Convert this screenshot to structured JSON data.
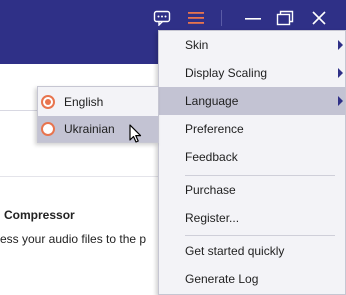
{
  "titlebar": {
    "icons": [
      "chat-icon",
      "menu-icon",
      "minimize-icon",
      "restore-icon",
      "close-icon"
    ],
    "menu_icon_color": "#e8744e"
  },
  "background": {
    "app_name": "Compressor",
    "description": "ess your audio files to the p"
  },
  "menu": {
    "items": [
      {
        "label": "Skin",
        "has_submenu": true
      },
      {
        "label": "Display Scaling",
        "has_submenu": true
      },
      {
        "label": "Language",
        "has_submenu": true,
        "active": true
      },
      {
        "label": "Preference"
      },
      {
        "label": "Feedback"
      },
      {
        "label": "Purchase"
      },
      {
        "label": "Register..."
      },
      {
        "label": "Get started quickly"
      },
      {
        "label": "Generate Log"
      }
    ]
  },
  "language_submenu": {
    "items": [
      {
        "label": "English",
        "selected": true
      },
      {
        "label": "Ukrainian",
        "hovered": true
      }
    ]
  },
  "colors": {
    "titlebar": "#2f3087",
    "accent": "#e8744e",
    "highlight": "#c3c3d3",
    "menu_bg": "#f3f3f7"
  }
}
